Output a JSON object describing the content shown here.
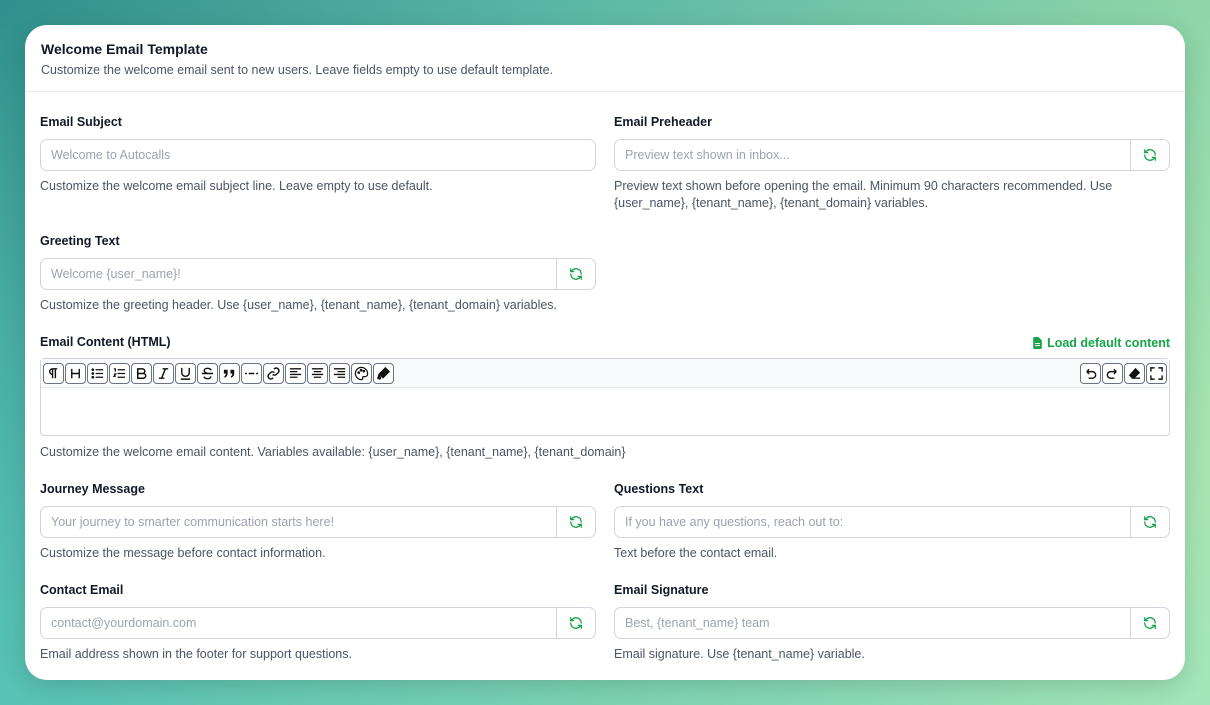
{
  "header": {
    "title": "Welcome Email Template",
    "description": "Customize the welcome email sent to new users. Leave fields empty to use default template."
  },
  "fields": {
    "subject": {
      "label": "Email Subject",
      "placeholder": "Welcome to Autocalls",
      "value": "",
      "help": "Customize the welcome email subject line. Leave empty to use default."
    },
    "preheader": {
      "label": "Email Preheader",
      "placeholder": "Preview text shown in inbox...",
      "value": "",
      "help": "Preview text shown before opening the email. Minimum 90 characters recommended. Use {user_name}, {tenant_name}, {tenant_domain} variables."
    },
    "greeting": {
      "label": "Greeting Text",
      "placeholder": "Welcome {user_name}!",
      "value": "",
      "help": "Customize the greeting header. Use {user_name}, {tenant_name}, {tenant_domain} variables."
    },
    "journey": {
      "label": "Journey Message",
      "placeholder": "Your journey to smarter communication starts here!",
      "value": "",
      "help": "Customize the message before contact information."
    },
    "questions": {
      "label": "Questions Text",
      "placeholder": "If you have any questions, reach out to:",
      "value": "",
      "help": "Text before the contact email."
    },
    "contact": {
      "label": "Contact Email",
      "placeholder": "contact@yourdomain.com",
      "value": "",
      "help": "Email address shown in the footer for support questions."
    },
    "signature": {
      "label": "Email Signature",
      "placeholder": "Best, {tenant_name} team",
      "value": "",
      "help": "Email signature. Use {tenant_name} variable."
    }
  },
  "editor": {
    "label": "Email Content (HTML)",
    "load_default_label": "Load default content",
    "help": "Customize the welcome email content. Variables available: {user_name}, {tenant_name}, {tenant_domain}",
    "toolbar_left": [
      "paragraph-icon",
      "heading-icon",
      "bullet-list-icon",
      "ordered-list-icon",
      "bold-icon",
      "italic-icon",
      "underline-icon",
      "strikethrough-icon",
      "blockquote-icon",
      "horizontal-rule-icon",
      "link-icon",
      "align-left-icon",
      "align-center-icon",
      "align-right-icon",
      "palette-icon",
      "highlighter-icon"
    ],
    "toolbar_right": [
      "undo-icon",
      "redo-icon",
      "eraser-icon",
      "fullscreen-icon"
    ]
  },
  "colors": {
    "accent": "#16a34a",
    "border": "#d1d5db"
  }
}
